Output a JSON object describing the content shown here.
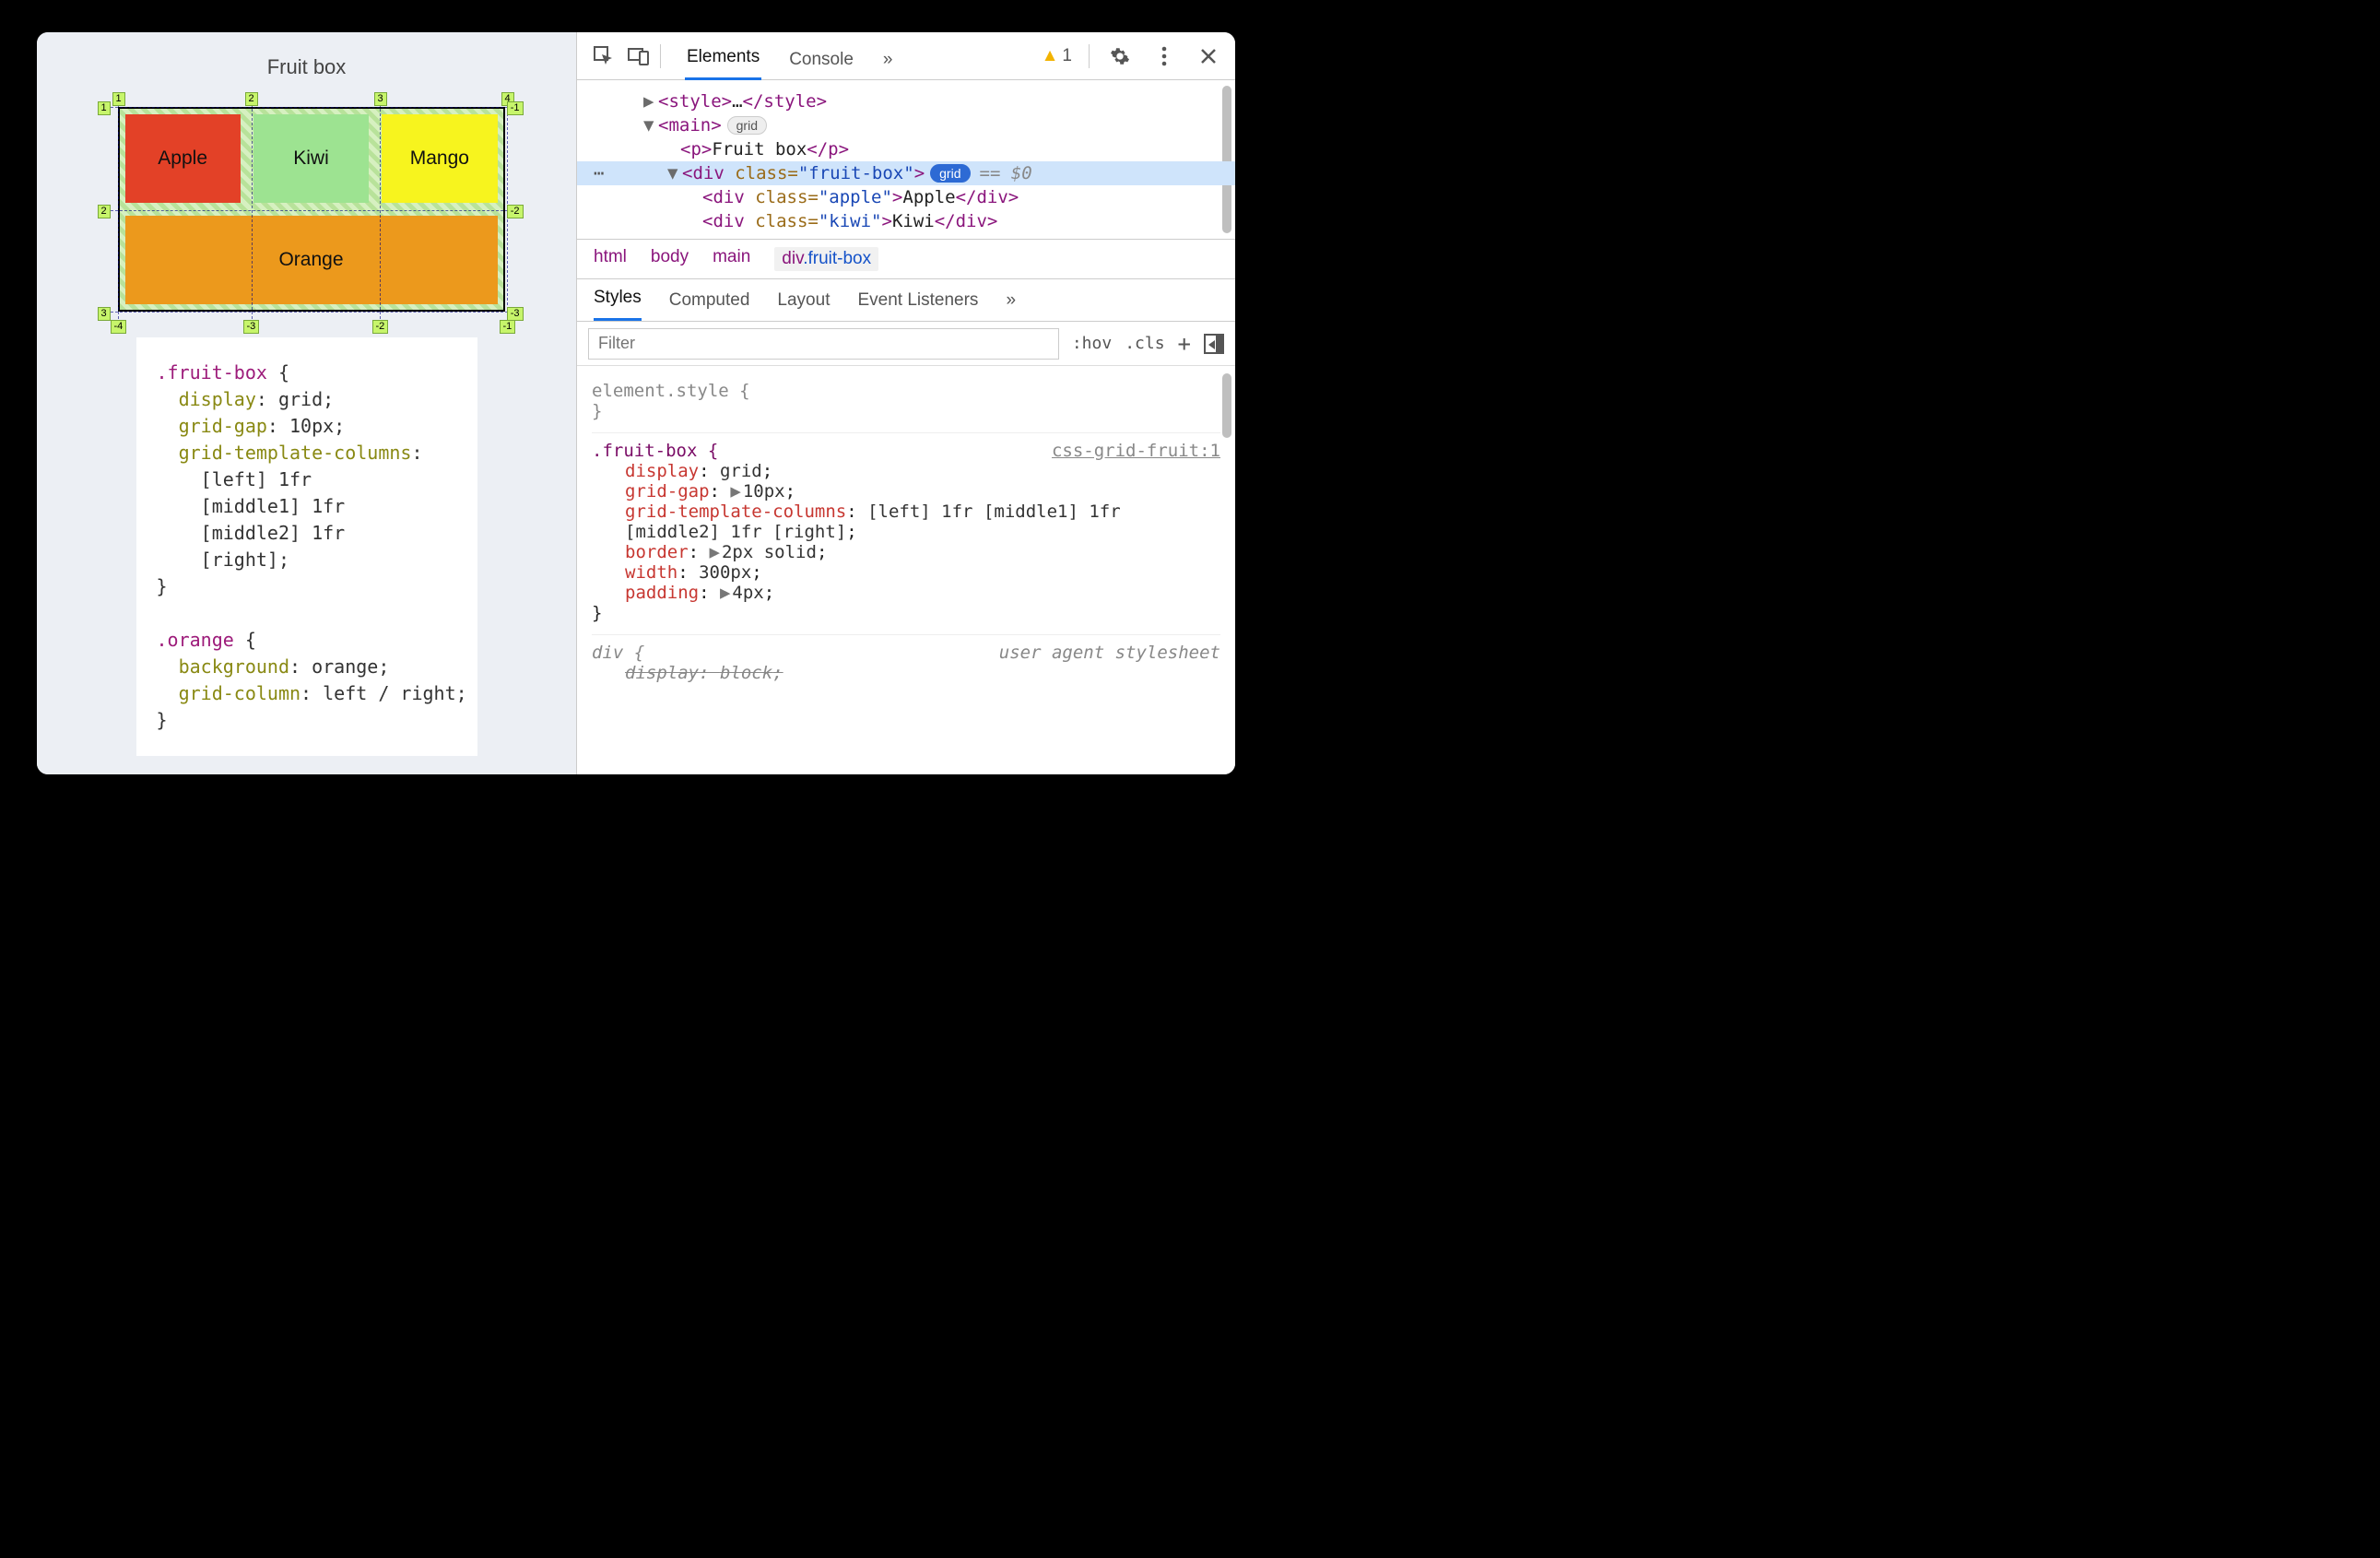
{
  "page": {
    "title": "Fruit box",
    "cells": {
      "apple": "Apple",
      "kiwi": "Kiwi",
      "mango": "Mango",
      "orange": "Orange"
    },
    "grid_labels": {
      "top": [
        "1",
        "2",
        "3",
        "4"
      ],
      "left": [
        "1",
        "2",
        "3"
      ],
      "right": [
        "-1",
        "-2",
        "-3"
      ],
      "bottom": [
        "-4",
        "-3",
        "-2",
        "-1"
      ]
    },
    "css_src": ".fruit-box {\n  display: grid;\n  grid-gap: 10px;\n  grid-template-columns:\n    [left] 1fr\n    [middle1] 1fr\n    [middle2] 1fr\n    [right];\n}\n\n.orange {\n  background: orange;\n  grid-column: left / right;\n}"
  },
  "devtools": {
    "tabs": {
      "elements": "Elements",
      "console": "Console",
      "overflow": "»"
    },
    "warn_count": "1",
    "dom": {
      "style_open": "<style>",
      "style_ellipsis": "…",
      "style_close": "</style>",
      "main_open": "<main>",
      "main_chip": "grid",
      "p_open": "<p>",
      "p_text": "Fruit box",
      "p_close": "</p>",
      "fb_open_a": "<div ",
      "fb_attr": "class=",
      "fb_val": "\"fruit-box\"",
      "fb_open_b": ">",
      "fb_chip": "grid",
      "fb_eq": "== $0",
      "apple_a": "<div ",
      "apple_attr": "class=",
      "apple_val": "\"apple\"",
      "apple_b": ">",
      "apple_t": "Apple",
      "apple_c": "</div>",
      "kiwi_a": "<div ",
      "kiwi_attr": "class=",
      "kiwi_val": "\"kiwi\"",
      "kiwi_b": ">",
      "kiwi_t": "Kiwi",
      "kiwi_c": "</div>"
    },
    "breadcrumb": {
      "a": "html",
      "b": "body",
      "c": "main",
      "d_el": "div",
      "d_cls": ".fruit-box"
    },
    "subtabs": {
      "styles": "Styles",
      "computed": "Computed",
      "layout": "Layout",
      "events": "Event Listeners",
      "overflow": "»"
    },
    "filter_placeholder": "Filter",
    "filter_controls": {
      "hov": ":hov",
      "cls": ".cls"
    },
    "rules": {
      "r0_sel": "element.style {",
      "r0_close": "}",
      "r1_sel": ".fruit-box {",
      "r1_src": "css-grid-fruit:1",
      "r1_d1_p": "display",
      "r1_d1_v": "grid",
      "r1_d2_p": "grid-gap",
      "r1_d2_v": "10px",
      "r1_d3_p": "grid-template-columns",
      "r1_d3_v": "[left] 1fr [middle1] 1fr [middle2] 1fr [right]",
      "r1_d4_p": "border",
      "r1_d4_v": "2px solid",
      "r1_d5_p": "width",
      "r1_d5_v": "300px",
      "r1_d6_p": "padding",
      "r1_d6_v": "4px",
      "r1_close": "}",
      "r2_sel": "div {",
      "r2_src": "user agent stylesheet",
      "r2_d1_p": "display",
      "r2_d1_v": "block"
    }
  }
}
